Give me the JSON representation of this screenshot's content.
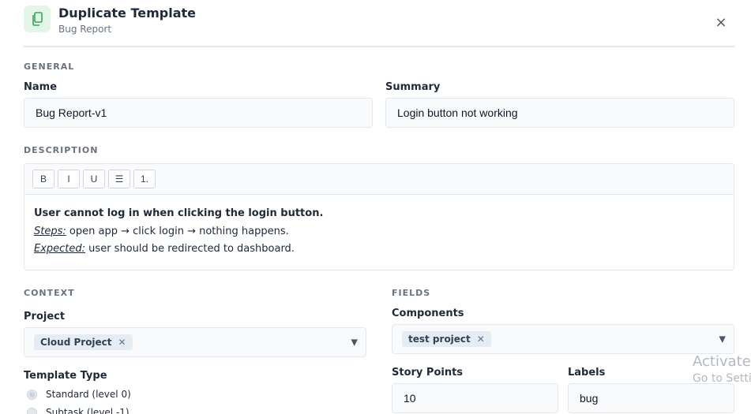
{
  "header": {
    "title": "Duplicate Template",
    "subtitle": "Bug Report",
    "close_label": "×"
  },
  "general": {
    "section_label": "GENERAL",
    "name_label": "Name",
    "name_value": "Bug Report-v1",
    "summary_label": "Summary",
    "summary_value": "Login button not working"
  },
  "description": {
    "section_label": "DESCRIPTION",
    "toolbar": [
      "B",
      "I",
      "U",
      "☰",
      "1."
    ],
    "line1": "User cannot log in when clicking the login button.",
    "line2_label": "Steps:",
    "line2_text": " open app → click login → nothing happens.",
    "line3_label": "Expected:",
    "line3_text": " user should be redirected to dashboard."
  },
  "context": {
    "section_label": "CONTEXT",
    "project_label": "Project",
    "project_chip": "Cloud Project",
    "template_type_label": "Template Type",
    "options": [
      "Standard (level 0)",
      "Subtask (level -1)"
    ]
  },
  "fields": {
    "section_label": "FIELDS",
    "components_label": "Components",
    "components_chip": "test project",
    "story_points_label": "Story Points",
    "story_points_value": "10",
    "labels_label": "Labels",
    "labels_value": "bug"
  },
  "watermark": {
    "line1": "Activate",
    "line2": "Go to Setti"
  },
  "colors": {
    "accent_icon_bg": "#e3f5e8",
    "accent_icon_fg": "#3aa655",
    "input_bg": "#f8fafc",
    "chip_bg": "#e6ecf3"
  }
}
